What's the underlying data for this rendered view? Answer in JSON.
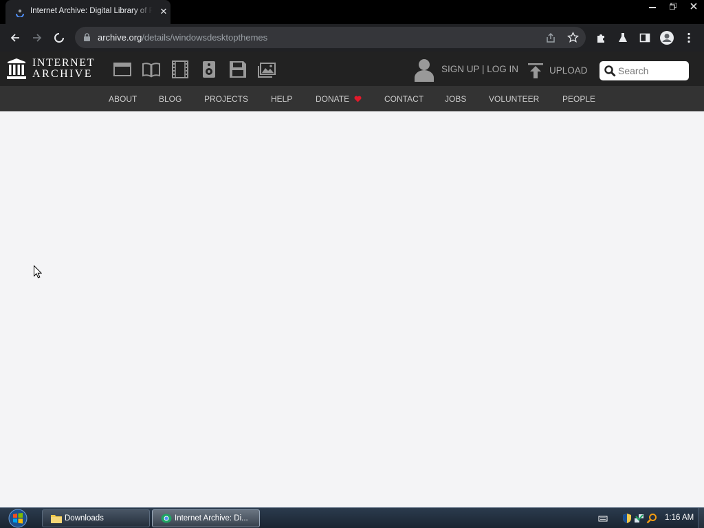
{
  "browser": {
    "tab_title": "Internet Archive: Digital Library of Free & Borrowable Books, Movies, Music & Wayback Machine",
    "url_host": "archive.org",
    "url_path": "/details/windowsdesktopthemes"
  },
  "header": {
    "logo_line1": "INTERNET",
    "logo_line2": "ARCHIVE",
    "signup_login": "SIGN UP | LOG IN",
    "upload": "UPLOAD",
    "search_placeholder": "Search",
    "media_icons": [
      "web-icon",
      "texts-icon",
      "video-icon",
      "audio-icon",
      "software-icon",
      "images-icon"
    ]
  },
  "nav": {
    "items": [
      "ABOUT",
      "BLOG",
      "PROJECTS",
      "HELP",
      "DONATE",
      "CONTACT",
      "JOBS",
      "VOLUNTEER",
      "PEOPLE"
    ]
  },
  "taskbar": {
    "buttons": [
      "Downloads",
      "Internet Archive: Di..."
    ],
    "clock": "1:16 AM"
  },
  "colors": {
    "header_bg": "#222222",
    "nav_bg": "#333333",
    "content_bg": "#f4f4f6",
    "donate_heart": "#e11a2b"
  }
}
